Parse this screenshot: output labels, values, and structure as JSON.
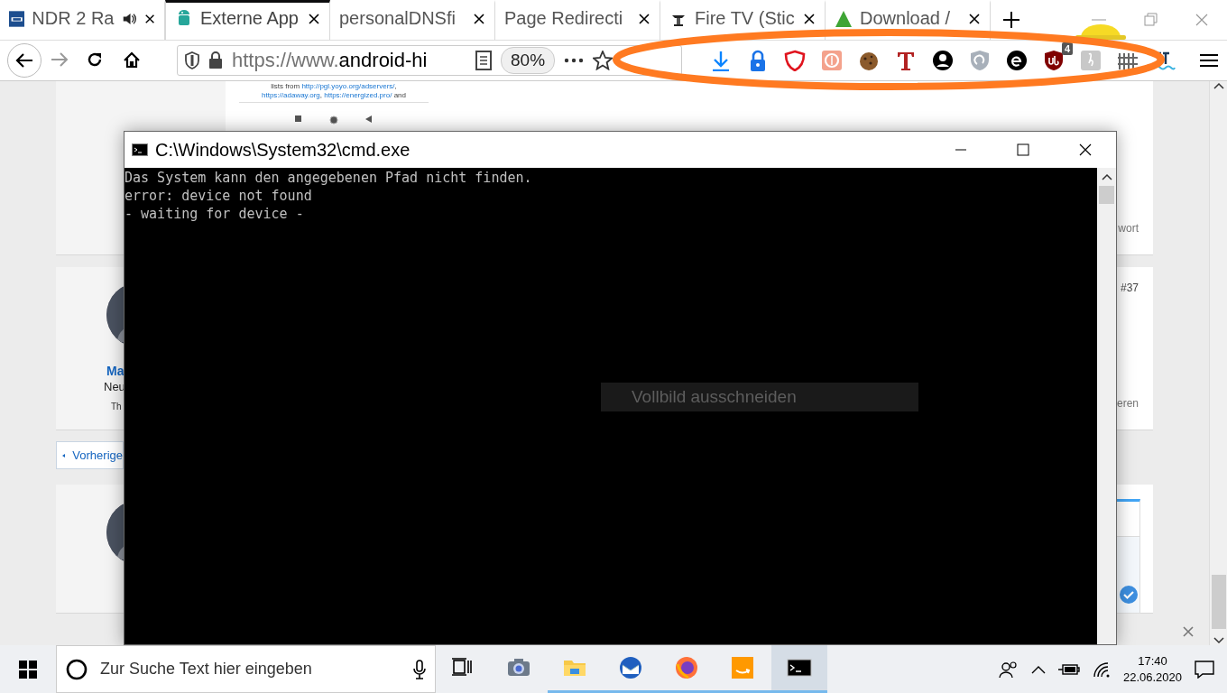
{
  "browser": {
    "tabs": [
      {
        "title": "NDR 2 Ra",
        "audio": true,
        "selected": false
      },
      {
        "title": "Externe App",
        "audio": false,
        "selected": true
      },
      {
        "title": "personalDNSfi",
        "audio": false,
        "selected": false
      },
      {
        "title": "Page Redirecti",
        "audio": false,
        "selected": false
      },
      {
        "title": "Fire TV (Stic",
        "audio": false,
        "selected": false
      },
      {
        "title": "Download /",
        "audio": false,
        "selected": false
      }
    ],
    "url": {
      "scheme": "https://www.",
      "host": "android-hi"
    },
    "zoom": "80%",
    "extension_badge": "4"
  },
  "page": {
    "snippet": [
      [
        {
          "text": "lists from ",
          "link": false
        },
        {
          "text": "http://pgl.yoyo.org/adservers/",
          "link": true
        },
        {
          "text": ",",
          "link": false
        }
      ],
      [
        {
          "text": "https://adaway.org",
          "link": true
        },
        {
          "text": ", ",
          "link": false
        },
        {
          "text": "https://energized.pro/",
          "link": true
        },
        {
          "text": " and",
          "link": false
        }
      ]
    ],
    "post_footer": "wort",
    "post_number": "#37",
    "author": "Ma",
    "rank": "Neu",
    "author_note": "Th",
    "post_action": "eren",
    "previous": "Vorherige"
  },
  "console": {
    "title": "C:\\Windows\\System32\\cmd.exe",
    "lines": [
      "Das System kann den angegebenen Pfad nicht finden.",
      "error: device not found",
      "- waiting for device -"
    ]
  },
  "tooltip": "Vollbild ausschneiden",
  "taskbar": {
    "search": {
      "placeholder": "Zur Suche Text hier eingeben"
    },
    "apps": [
      {
        "running": false,
        "selected": false
      },
      {
        "running": false,
        "selected": false
      },
      {
        "running": true,
        "selected": false
      },
      {
        "running": true,
        "selected": false
      },
      {
        "running": true,
        "selected": false
      },
      {
        "running": true,
        "selected": false
      },
      {
        "running": true,
        "selected": true
      }
    ],
    "time": "17:40",
    "date": "22.06.2020"
  }
}
